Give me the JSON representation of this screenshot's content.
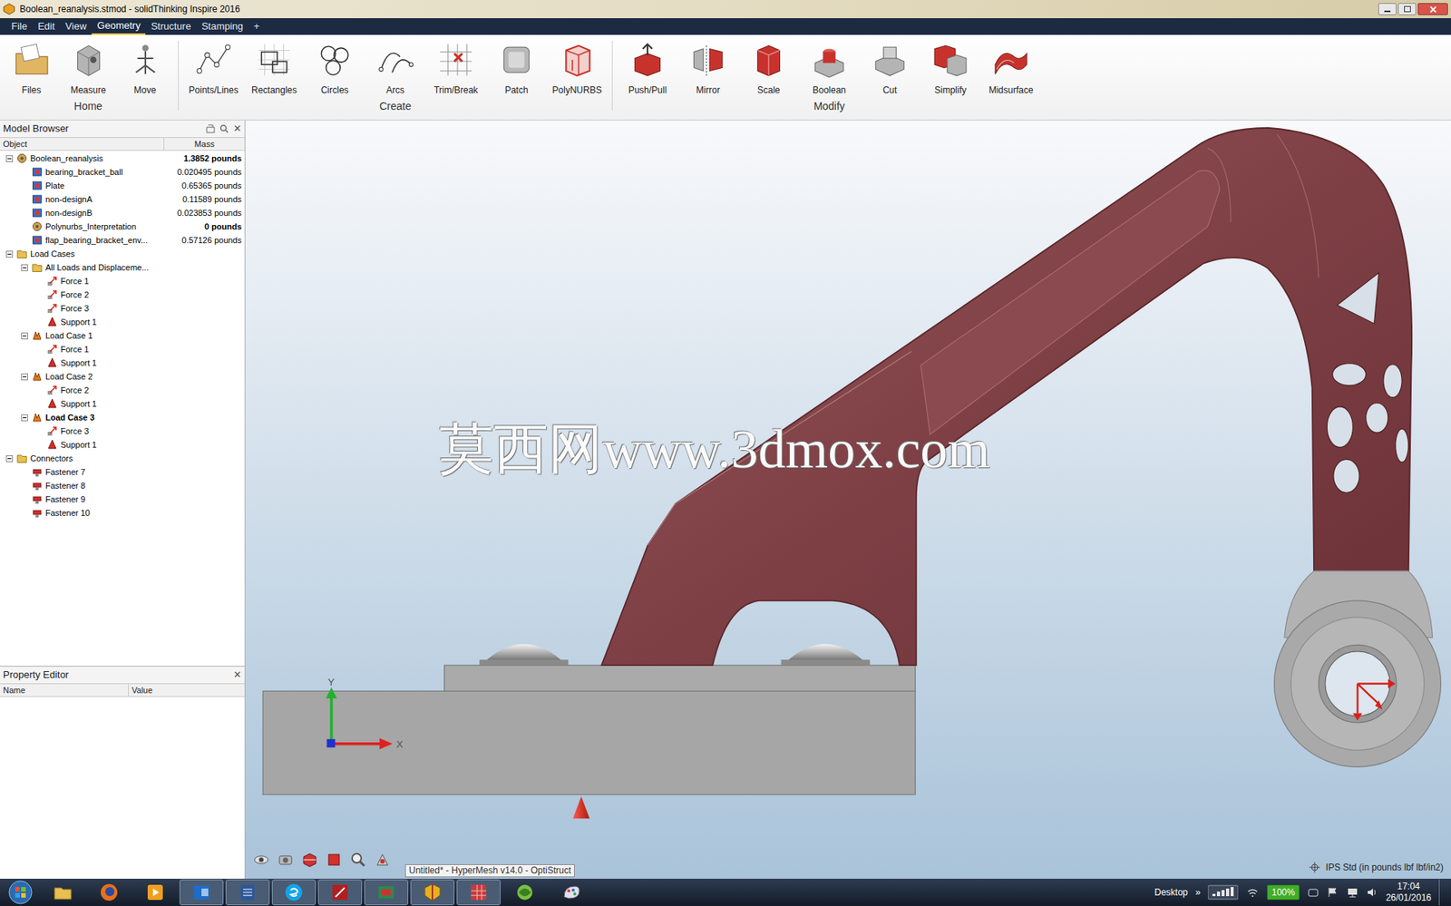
{
  "window": {
    "title": "Boolean_reanalysis.stmod - solidThinking Inspire 2016"
  },
  "menu": [
    {
      "label": "File",
      "selected": false
    },
    {
      "label": "Edit",
      "selected": false
    },
    {
      "label": "View",
      "selected": false
    },
    {
      "label": "Geometry",
      "selected": true
    },
    {
      "label": "Structure",
      "selected": false
    },
    {
      "label": "Stamping",
      "selected": false
    },
    {
      "label": "+",
      "selected": false
    }
  ],
  "ribbon": [
    {
      "group": "Home",
      "buttons": [
        "Files",
        "Measure",
        "Move"
      ]
    },
    {
      "group": "Create",
      "buttons": [
        "Points/Lines",
        "Rectangles",
        "Circles",
        "Arcs",
        "Trim/Break",
        "Patch",
        "PolyNURBS"
      ]
    },
    {
      "group": "Modify",
      "buttons": [
        "Push/Pull",
        "Mirror",
        "Scale",
        "Boolean",
        "Cut",
        "Simplify",
        "Midsurface"
      ]
    }
  ],
  "model_browser": {
    "title": "Model Browser",
    "close": "✕",
    "columns": [
      "Object",
      "Mass"
    ],
    "rows": [
      {
        "label": "Boolean_reanalysis",
        "mass": "1.3852 pounds",
        "level": 0,
        "kind": "model",
        "expandable": true,
        "expanded": true,
        "bold_mass": true,
        "active": false
      },
      {
        "label": "bearing_bracket_ball",
        "mass": "0.020495 pounds",
        "level": 1,
        "kind": "part",
        "expandable": false,
        "expanded": false,
        "bold_mass": false,
        "active": false
      },
      {
        "label": "Plate",
        "mass": "0.65365 pounds",
        "level": 1,
        "kind": "part",
        "expandable": false,
        "expanded": false,
        "bold_mass": false,
        "active": false
      },
      {
        "label": "non-designA",
        "mass": "0.11589 pounds",
        "level": 1,
        "kind": "part",
        "expandable": false,
        "expanded": false,
        "bold_mass": false,
        "active": false
      },
      {
        "label": "non-designB",
        "mass": "0.023853 pounds",
        "level": 1,
        "kind": "part",
        "expandable": false,
        "expanded": false,
        "bold_mass": false,
        "active": false
      },
      {
        "label": "Polynurbs_Interpretation",
        "mass": "0 pounds",
        "level": 1,
        "kind": "model",
        "expandable": false,
        "expanded": false,
        "bold_mass": true,
        "active": false
      },
      {
        "label": "flap_bearing_bracket_env...",
        "mass": "0.57126 pounds",
        "level": 1,
        "kind": "part",
        "expandable": false,
        "expanded": false,
        "bold_mass": false,
        "active": false
      },
      {
        "label": "Load Cases",
        "mass": "",
        "level": 0,
        "kind": "folder",
        "expandable": true,
        "expanded": true,
        "bold_mass": false,
        "active": false
      },
      {
        "label": "All Loads and Displaceme...",
        "mass": "",
        "level": 1,
        "kind": "folder",
        "expandable": true,
        "expanded": true,
        "bold_mass": false,
        "active": false
      },
      {
        "label": "Force 1",
        "mass": "",
        "level": 2,
        "kind": "force",
        "expandable": false,
        "expanded": false,
        "bold_mass": false,
        "active": false
      },
      {
        "label": "Force 2",
        "mass": "",
        "level": 2,
        "kind": "force",
        "expandable": false,
        "expanded": false,
        "bold_mass": false,
        "active": false
      },
      {
        "label": "Force 3",
        "mass": "",
        "level": 2,
        "kind": "force",
        "expandable": false,
        "expanded": false,
        "bold_mass": false,
        "active": false
      },
      {
        "label": "Support 1",
        "mass": "",
        "level": 2,
        "kind": "support",
        "expandable": false,
        "expanded": false,
        "bold_mass": false,
        "active": false
      },
      {
        "label": "Load Case 1",
        "mass": "",
        "level": 1,
        "kind": "loadcase",
        "expandable": true,
        "expanded": true,
        "bold_mass": false,
        "active": false
      },
      {
        "label": "Force 1",
        "mass": "",
        "level": 2,
        "kind": "force",
        "expandable": false,
        "expanded": false,
        "bold_mass": false,
        "active": false
      },
      {
        "label": "Support 1",
        "mass": "",
        "level": 2,
        "kind": "support",
        "expandable": false,
        "expanded": false,
        "bold_mass": false,
        "active": false
      },
      {
        "label": "Load Case 2",
        "mass": "",
        "level": 1,
        "kind": "loadcase",
        "expandable": true,
        "expanded": true,
        "bold_mass": false,
        "active": false
      },
      {
        "label": "Force 2",
        "mass": "",
        "level": 2,
        "kind": "force",
        "expandable": false,
        "expanded": false,
        "bold_mass": false,
        "active": false
      },
      {
        "label": "Support 1",
        "mass": "",
        "level": 2,
        "kind": "support",
        "expandable": false,
        "expanded": false,
        "bold_mass": false,
        "active": false
      },
      {
        "label": "Load Case 3",
        "mass": "",
        "level": 1,
        "kind": "loadcase",
        "expandable": true,
        "expanded": true,
        "bold_mass": false,
        "active": true
      },
      {
        "label": "Force 3",
        "mass": "",
        "level": 2,
        "kind": "force",
        "expandable": false,
        "expanded": false,
        "bold_mass": false,
        "active": false
      },
      {
        "label": "Support 1",
        "mass": "",
        "level": 2,
        "kind": "support",
        "expandable": false,
        "expanded": false,
        "bold_mass": false,
        "active": false
      },
      {
        "label": "Connectors",
        "mass": "",
        "level": 0,
        "kind": "folder",
        "expandable": true,
        "expanded": true,
        "bold_mass": false,
        "active": false
      },
      {
        "label": "Fastener 7",
        "mass": "",
        "level": 1,
        "kind": "connector",
        "expandable": false,
        "expanded": false,
        "bold_mass": false,
        "active": false
      },
      {
        "label": "Fastener 8",
        "mass": "",
        "level": 1,
        "kind": "connector",
        "expandable": false,
        "expanded": false,
        "bold_mass": false,
        "active": false
      },
      {
        "label": "Fastener 9",
        "mass": "",
        "level": 1,
        "kind": "connector",
        "expandable": false,
        "expanded": false,
        "bold_mass": false,
        "active": false
      },
      {
        "label": "Fastener 10",
        "mass": "",
        "level": 1,
        "kind": "connector",
        "expandable": false,
        "expanded": false,
        "bold_mass": false,
        "active": false
      }
    ]
  },
  "property_editor": {
    "title": "Property Editor",
    "close": "✕",
    "columns": [
      "Name",
      "Value"
    ]
  },
  "viewport": {
    "watermark": "莫西网www.3dmox.com",
    "axes": {
      "x": "X",
      "y": "Y"
    },
    "units": "IPS Std (in pounds lbf lbf/in2)"
  },
  "tooltip": "Untitled* - HyperMesh v14.0 - OptiStruct",
  "taskbar": {
    "apps": [
      {
        "running": false
      },
      {
        "running": false
      },
      {
        "running": false
      },
      {
        "running": true
      },
      {
        "running": true
      },
      {
        "running": true
      },
      {
        "running": true
      },
      {
        "running": true
      },
      {
        "running": true
      },
      {
        "running": true
      },
      {
        "running": false
      },
      {
        "running": false
      }
    ],
    "desktop": "Desktop",
    "chevron": "»",
    "battery": "100%",
    "time": "17:04",
    "date": "26/01/2016"
  }
}
